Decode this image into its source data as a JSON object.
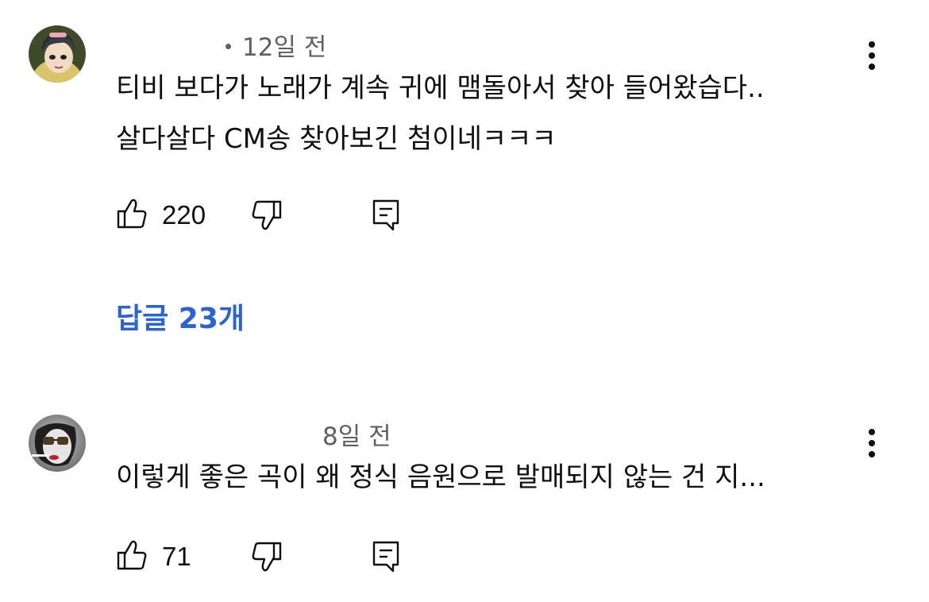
{
  "comments": [
    {
      "time_ago": "12일 전",
      "text_line1": "티비 보다가 노래가 계속 귀에 맴돌아서 찾아 들어왔습다..",
      "text_line2": "살다살다 CM송 찾아보긴 첨이네ㅋㅋㅋ",
      "like_count": "220",
      "replies_label": "답글 23개",
      "avatar_icon": "cartoon-avatar-icon"
    },
    {
      "time_ago": "8일 전",
      "text_line1": "이렇게 좋은 곡이 왜 정식 음원으로 발매되지 않는 건 지...",
      "like_count": "71",
      "avatar_icon": "photo-avatar-icon"
    }
  ],
  "icons": {
    "like": "thumbs-up-icon",
    "dislike": "thumbs-down-icon",
    "reply": "reply-icon",
    "more": "more-vertical-icon"
  },
  "colors": {
    "text": "#0f0f0f",
    "meta": "#606060",
    "link": "#2a63d4",
    "background": "#ffffff"
  }
}
